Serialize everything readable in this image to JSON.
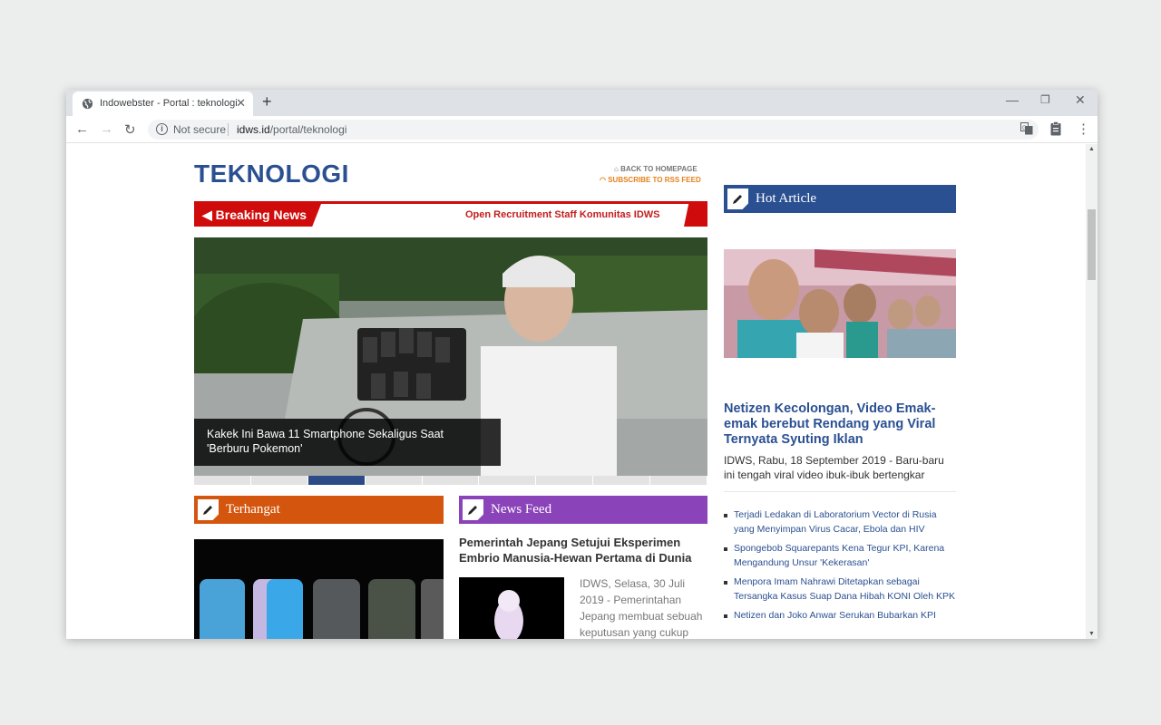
{
  "browser": {
    "tab_title": "Indowebster - Portal : teknologi",
    "tab_close": "✕",
    "new_tab": "+",
    "minimize": "—",
    "restore": "❐",
    "close": "✕",
    "not_secure": "Not secure",
    "url_host": "idws.id",
    "url_path": "/portal/teknologi",
    "back": "←",
    "forward": "→",
    "reload": "↻",
    "menu": "⋮"
  },
  "page": {
    "title": "TEKNOLOGI",
    "back_home": "BACK TO HOMEPAGE",
    "rss": "SUBSCRIBE TO RSS FEED",
    "breaking_label": "Breaking News",
    "breaking_text": "Open Recruitment Staff Komunitas IDWS",
    "hero_caption": "Kakek Ini Bawa 11 Smartphone Sekaligus Saat 'Berburu Pokemon'",
    "slider_count": 9,
    "slider_active": 3,
    "terhangat_label": "Terhangat",
    "newsfeed_label": "News Feed",
    "newsfeed_title": "Pemerintah Jepang Setujui Eksperimen Embrio Manusia-Hewan Pertama di Dunia",
    "newsfeed_excerpt": "IDWS, Selasa, 30 Juli 2019 - Pemerintahan Jepang membuat sebuah keputusan yang cukup",
    "hot_label": "Hot Article",
    "hot_title": "Netizen Kecolongan, Video Emak-emak berebut Rendang yang Viral Ternyata Syuting Iklan",
    "hot_excerpt": "IDWS, Rabu, 18 September 2019 - Baru-baru ini tengah viral video ibuk-ibuk bertengkar",
    "hot_list": [
      "Terjadi Ledakan di Laboratorium Vector di Rusia yang Menyimpan Virus Cacar, Ebola dan HIV",
      "Spongebob Squarepants Kena Tegur KPI, Karena Mengandung Unsur 'Kekerasan'",
      "Menpora Imam Nahrawi Ditetapkan sebagai Tersangka Kasus Suap Dana Hibah KONI Oleh KPK",
      "Netizen dan Joko Anwar Serukan Bubarkan KPI"
    ]
  },
  "colors": {
    "brand_blue": "#2b5092",
    "breaking_red": "#d00b0b",
    "terhangat_orange": "#d4560e",
    "newsfeed_purple": "#8a43b8"
  }
}
